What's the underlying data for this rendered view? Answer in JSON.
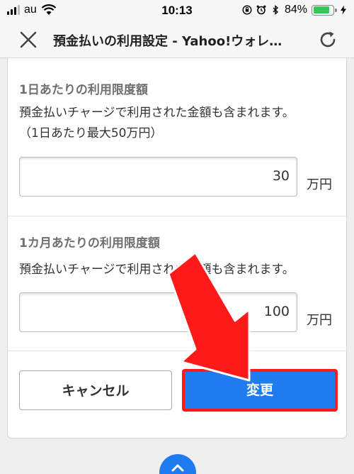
{
  "status_bar": {
    "carrier": "au",
    "time": "10:13",
    "battery_percent": "84%",
    "battery_level": 0.84
  },
  "header": {
    "title": "預金払いの利用設定 - Yahoo!ウォレ…"
  },
  "daily_limit": {
    "title": "1日あたりの利用限度額",
    "desc1": "預金払いチャージで利用された金額も含まれます。",
    "desc2": "（1日あたり最大50万円）",
    "value": "30",
    "unit": "万円"
  },
  "monthly_limit": {
    "title": "1カ月あたりの利用限度額",
    "desc1": "預金払いチャージで利用された金額も含まれます。",
    "value": "100",
    "unit": "万円"
  },
  "buttons": {
    "cancel_label": "キャンセル",
    "change_label": "変更"
  },
  "colors": {
    "primary": "#1e7bf0",
    "highlight": "#ff1a1a"
  }
}
